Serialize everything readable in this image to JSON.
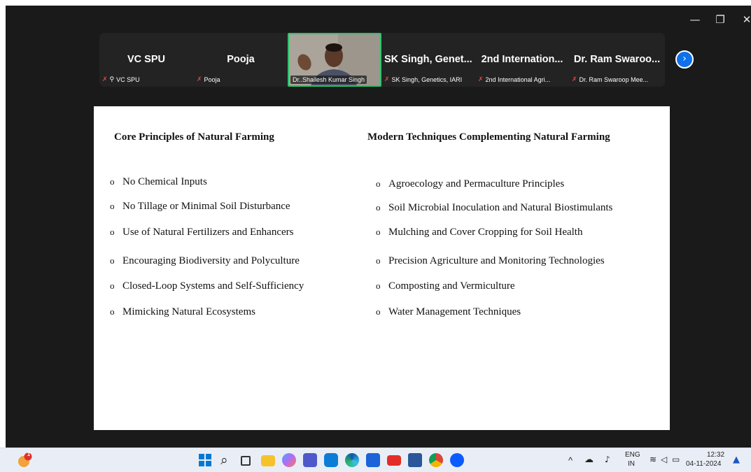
{
  "window_controls": {
    "minimize": "—",
    "restore": "❐",
    "close": "✕"
  },
  "gallery": {
    "tiles": [
      {
        "name": "VC SPU",
        "label": "VC SPU",
        "muted": true,
        "pinned": true
      },
      {
        "name": "Pooja",
        "label": "Pooja",
        "muted": true,
        "pinned": false
      },
      {
        "name": "",
        "label": "Dr..Shailesh Kumar Singh",
        "muted": false,
        "active_speaker": true
      },
      {
        "name": "SK Singh, Genet...",
        "label": "SK Singh, Genetics, IARI",
        "muted": true
      },
      {
        "name": "2nd Internation...",
        "label": "2nd International Agri...",
        "muted": true
      },
      {
        "name": "Dr. Ram Swaroo...",
        "label": "Dr. Ram Swaroop Mee...",
        "muted": true
      }
    ],
    "next_page_icon": "›"
  },
  "slide": {
    "left_heading": "Core Principles of Natural Farming",
    "right_heading": "Modern Techniques Complementing Natural Farming",
    "bullet_marker": "o",
    "left_items": [
      "No Chemical Inputs",
      "No Tillage or Minimal Soil Disturbance",
      "Use of Natural Fertilizers and Enhancers",
      "Encouraging Biodiversity and Polyculture",
      "Closed-Loop Systems and Self-Sufficiency",
      "Mimicking Natural Ecosystems"
    ],
    "right_items": [
      "Agroecology and Permaculture Principles",
      "Soil Microbial Inoculation and Natural Biostimulants",
      "Mulching and Cover Cropping for Soil Health",
      "Precision Agriculture and Monitoring Technologies",
      "Composting and Vermiculture",
      "Water Management Techniques"
    ]
  },
  "taskbar": {
    "notification_badge": "1",
    "search_icon": "⌕",
    "tray_chevron": "^",
    "lang_top": "ENG",
    "lang_bottom": "IN",
    "time": "12:32",
    "date": "04-11-2024",
    "colors": {
      "windows_blue": "#0078d4",
      "zoom_blue": "#0b5cff",
      "bell": "#1a56c4"
    }
  }
}
